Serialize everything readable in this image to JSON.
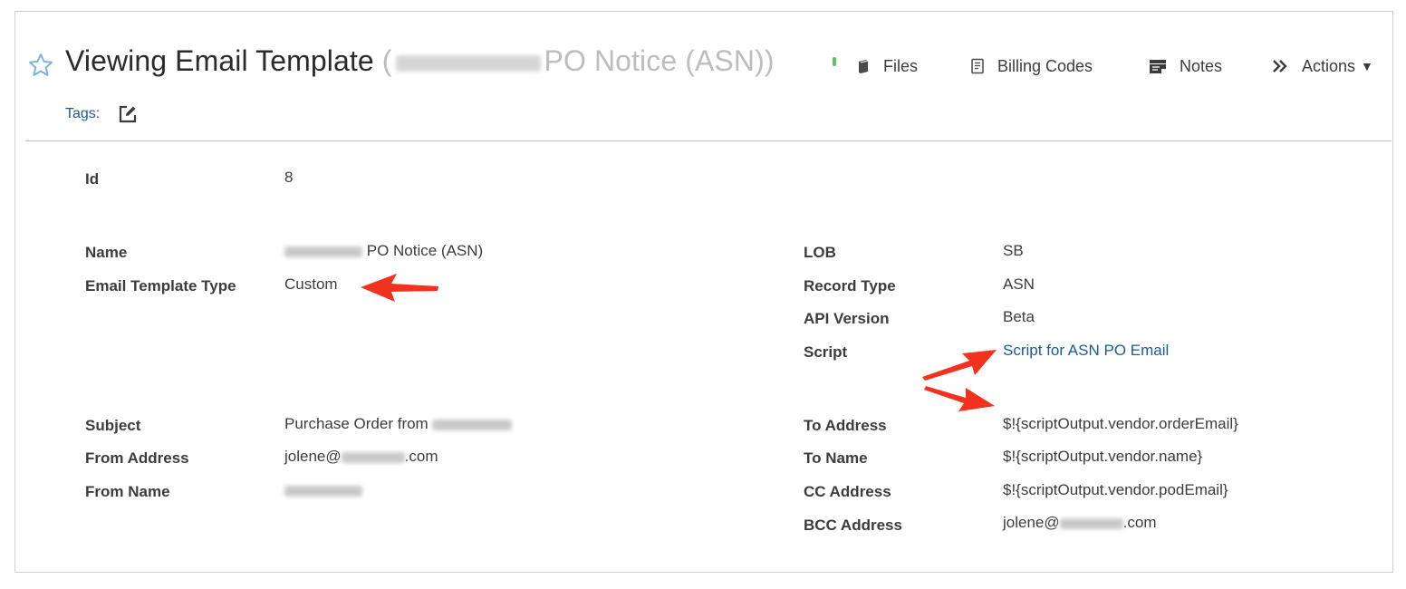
{
  "header": {
    "title": "Viewing Email Template",
    "subtitle_open": "(",
    "subtitle_rest": "PO Notice (ASN))",
    "star_icon": "star-outline-icon"
  },
  "toolbar": {
    "files_label": "Files",
    "billing_label": "Billing Codes",
    "notes_label": "Notes",
    "actions_label": "Actions",
    "actions_caret": "▼"
  },
  "tags": {
    "label": "Tags:"
  },
  "fields": {
    "id": {
      "label": "Id",
      "value": "8"
    },
    "name": {
      "label": "Name",
      "value_suffix": "PO Notice (ASN)"
    },
    "template_type": {
      "label": "Email Template Type",
      "value": "Custom"
    },
    "lob": {
      "label": "LOB",
      "value": "SB"
    },
    "record_type": {
      "label": "Record Type",
      "value": "ASN"
    },
    "api_version": {
      "label": "API Version",
      "value": "Beta"
    },
    "script": {
      "label": "Script",
      "value": "Script for ASN PO Email"
    },
    "subject": {
      "label": "Subject",
      "value_prefix": "Purchase Order from"
    },
    "from_address": {
      "label": "From Address",
      "value_prefix": "jolene@",
      "value_suffix": ".com"
    },
    "from_name": {
      "label": "From Name"
    },
    "to_address": {
      "label": "To Address",
      "value": "$!{scriptOutput.vendor.orderEmail}"
    },
    "to_name": {
      "label": "To Name",
      "value": "$!{scriptOutput.vendor.name}"
    },
    "cc_address": {
      "label": "CC Address",
      "value": "$!{scriptOutput.vendor.podEmail}"
    },
    "bcc_address": {
      "label": "BCC Address",
      "value_prefix": "jolene@",
      "value_suffix": ".com"
    }
  },
  "colors": {
    "link": "#1a5a9a",
    "annotation_arrow": "#f0321e",
    "star": "#7fb2de"
  }
}
